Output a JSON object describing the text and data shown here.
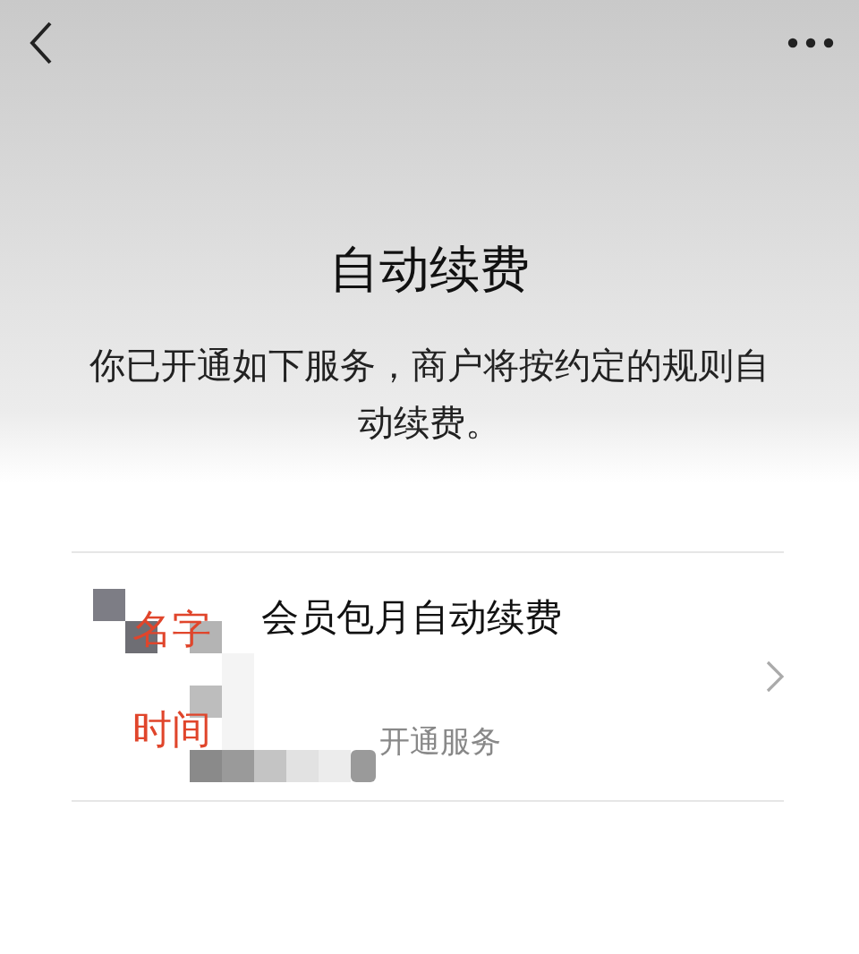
{
  "title": "自动续费",
  "description": "你已开通如下服务，商户将按约定的规则自动续费。",
  "services": [
    {
      "name": "会员包月自动续费",
      "status": "开通服务"
    }
  ],
  "annotations": [
    "名字",
    "时间"
  ]
}
